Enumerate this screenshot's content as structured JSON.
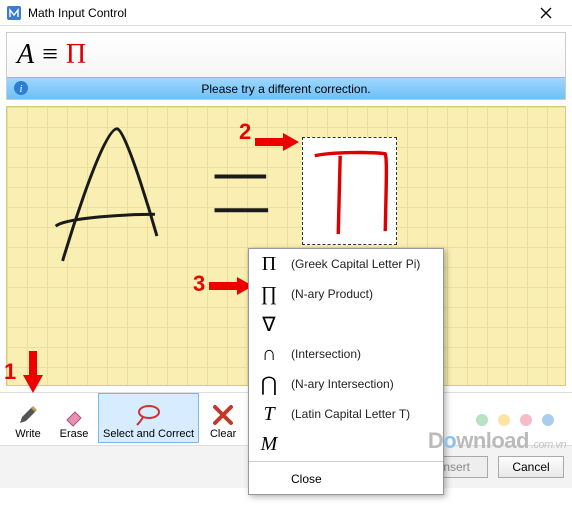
{
  "window": {
    "title": "Math Input Control",
    "close_label": "Close"
  },
  "preview": {
    "A": "A",
    "eq": "≡",
    "pi": "Π"
  },
  "status": {
    "message": "Please try a different correction."
  },
  "toolbar": {
    "write": "Write",
    "erase": "Erase",
    "select_correct": "Select and Correct",
    "clear": "Clear"
  },
  "bottom": {
    "insert": "Insert",
    "cancel": "Cancel"
  },
  "popup": {
    "items": [
      {
        "symbol": "Π",
        "desc": "(Greek Capital Letter Pi)"
      },
      {
        "symbol": "∏",
        "desc": "(N-ary Product)"
      },
      {
        "symbol": "∇",
        "desc": ""
      },
      {
        "symbol": "∩",
        "desc": "(Intersection)"
      },
      {
        "symbol": "⋂",
        "desc": "(N-ary Intersection)"
      },
      {
        "symbol": "T",
        "desc": "(Latin Capital Letter T)"
      },
      {
        "symbol": "M",
        "desc": ""
      }
    ],
    "close": "Close"
  },
  "callouts": {
    "c1": "1",
    "c2": "2",
    "c3": "3"
  },
  "watermark": {
    "text_prefix": "D",
    "text_mid": "o",
    "text_rest": "wnload",
    "tail": ".com.vn"
  },
  "dot_colors": [
    "#9ad6a7",
    "#ffd77a",
    "#f59fb0",
    "#86b8e8"
  ]
}
